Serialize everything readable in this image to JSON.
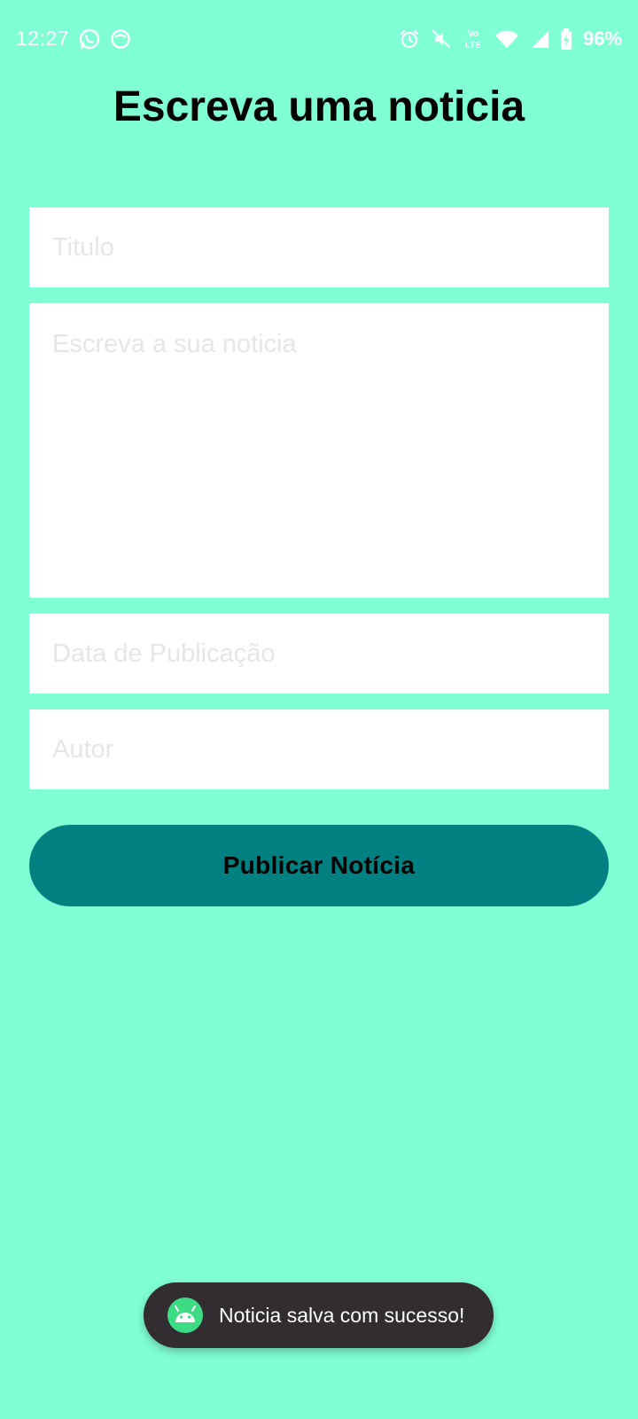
{
  "status_bar": {
    "time": "12:27",
    "battery": "96%",
    "network_label": "Vo LTE",
    "icons_left": [
      "whatsapp-icon",
      "app-notification-icon"
    ],
    "icons_right": [
      "alarm-icon",
      "mute-icon",
      "volte-icon",
      "wifi-icon",
      "signal-icon",
      "battery-icon"
    ]
  },
  "page": {
    "title": "Escreva uma noticia"
  },
  "form": {
    "title_placeholder": "Titulo",
    "body_placeholder": "Escreva a sua noticia",
    "date_placeholder": "Data de Publicação",
    "author_placeholder": "Autor",
    "title_value": "",
    "body_value": "",
    "date_value": "",
    "author_value": "",
    "publish_label": "Publicar Notícia"
  },
  "toast": {
    "message": "Noticia salva com sucesso!",
    "icon": "android-icon"
  },
  "colors": {
    "background": "#80FFD4",
    "button": "#008080",
    "toast": "#312D30",
    "android_green": "#3DDC84"
  }
}
